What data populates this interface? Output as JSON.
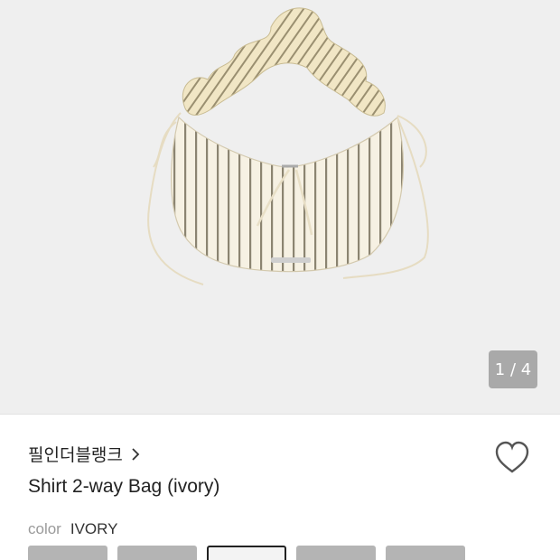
{
  "gallery": {
    "counter": "1 / 4",
    "background_color": "#efefef"
  },
  "product": {
    "brand": "필인더블랭크",
    "brand_arrow": "chevron-right-icon",
    "title": "Shirt 2-way Bag (ivory)",
    "color_label": "color",
    "color_value": "IVORY",
    "wishlist_icon": "heart-outline-icon"
  },
  "swatches": [
    {
      "selected": false
    },
    {
      "selected": false
    },
    {
      "selected": true
    },
    {
      "selected": false
    },
    {
      "selected": false
    }
  ]
}
